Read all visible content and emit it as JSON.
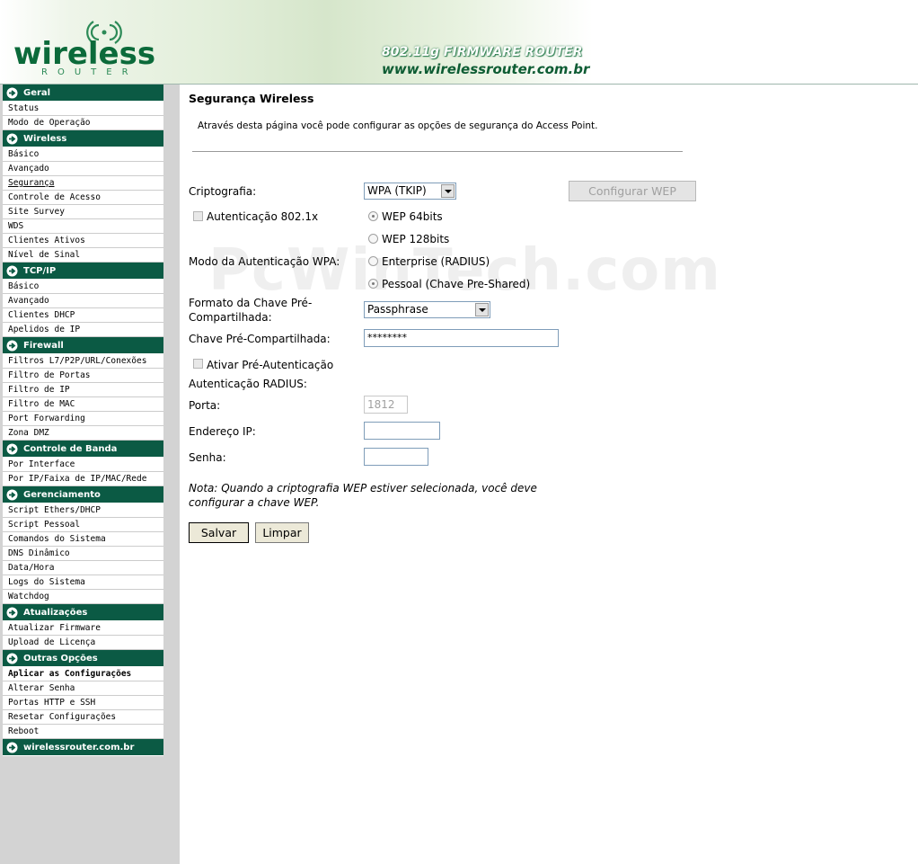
{
  "header": {
    "logo_text": "wireless",
    "logo_sub": "ROUTER",
    "line1": "802.11g FIRMWARE ROUTER",
    "line2": "www.wirelessrouter.com.br"
  },
  "sidebar": {
    "sections": [
      {
        "title": "Geral",
        "items": [
          "Status",
          "Modo de Operação"
        ]
      },
      {
        "title": "Wireless",
        "items": [
          "Básico",
          "Avançado",
          "Segurança",
          "Controle de Acesso",
          "Site Survey",
          "WDS",
          "Clientes Ativos",
          "Nível de Sinal"
        ]
      },
      {
        "title": "TCP/IP",
        "items": [
          "Básico",
          "Avançado",
          "Clientes DHCP",
          "Apelidos de IP"
        ]
      },
      {
        "title": "Firewall",
        "items": [
          "Filtros L7/P2P/URL/Conexões",
          "Filtro de Portas",
          "Filtro de IP",
          "Filtro de MAC",
          "Port Forwarding",
          "Zona DMZ"
        ]
      },
      {
        "title": "Controle de Banda",
        "items": [
          "Por Interface",
          "Por IP/Faixa de IP/MAC/Rede"
        ]
      },
      {
        "title": "Gerenciamento",
        "items": [
          "Script Ethers/DHCP",
          "Script Pessoal",
          "Comandos do Sistema",
          "DNS Dinâmico",
          "Data/Hora",
          "Logs do Sistema",
          "Watchdog"
        ]
      },
      {
        "title": "Atualizações",
        "items": [
          "Atualizar Firmware",
          "Upload de Licença"
        ]
      },
      {
        "title": "Outras Opções",
        "items": [
          "Aplicar as Configurações",
          "Alterar Senha",
          "Portas HTTP e SSH",
          "Resetar Configurações",
          "Reboot"
        ]
      },
      {
        "title": "wirelessrouter.com.br",
        "items": []
      }
    ]
  },
  "main": {
    "title": "Segurança Wireless",
    "description": "Através desta página você pode configurar as opções de segurança do Access Point.",
    "watermark": "PcWinTech.com",
    "criptografia_label": "Criptografia:",
    "criptografia_value": "WPA (TKIP)",
    "configurar_wep": "Configurar WEP",
    "auth8021x_label": "Autenticação 802.1x",
    "wep64": "WEP 64bits",
    "wep128": "WEP 128bits",
    "modo_wpa_label": "Modo da Autenticação WPA:",
    "enterprise": "Enterprise (RADIUS)",
    "pessoal": "Pessoal (Chave Pre-Shared)",
    "formato_label_1": "Formato da Chave Pré-",
    "formato_label_2": "Compartilhada:",
    "formato_value": "Passphrase",
    "chave_label": "Chave Pré-Compartilhada:",
    "chave_value": "********",
    "preauth_label": "Ativar Pré-Autenticação",
    "radius_label": "Autenticação RADIUS:",
    "porta_label": "Porta:",
    "porta_value": "1812",
    "ip_label": "Endereço IP:",
    "ip_value": "",
    "senha_label": "Senha:",
    "senha_value": "",
    "note_1": "Nota: Quando a criptografia WEP estiver selecionada, você deve",
    "note_2": "configurar a chave WEP.",
    "salvar": "Salvar",
    "limpar": "Limpar"
  },
  "colors": {
    "section_bg": "#0b5a44",
    "sidebar_bg": "#d3d3d3",
    "brand_green": "#0b6a3a"
  }
}
